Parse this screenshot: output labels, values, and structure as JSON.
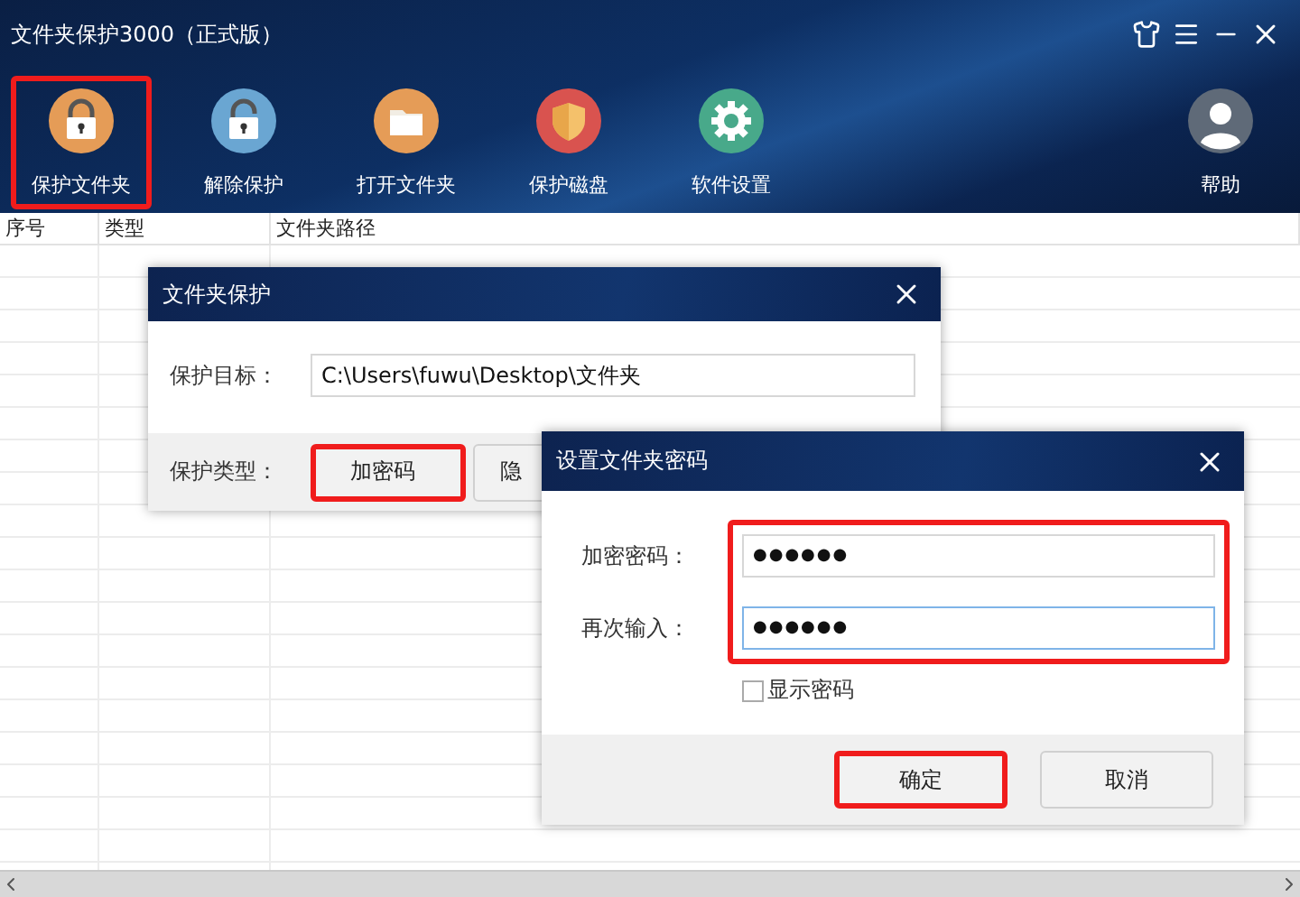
{
  "window": {
    "title": "文件夹保护3000（正式版）"
  },
  "toolbar": [
    {
      "label": "保护文件夹",
      "kind": "lock",
      "highlighted": true
    },
    {
      "label": "解除保护",
      "kind": "unlock",
      "highlighted": false
    },
    {
      "label": "打开文件夹",
      "kind": "folder",
      "highlighted": false
    },
    {
      "label": "保护磁盘",
      "kind": "shield",
      "highlighted": false
    },
    {
      "label": "软件设置",
      "kind": "gear",
      "highlighted": false
    }
  ],
  "help": {
    "label": "帮助"
  },
  "table": {
    "columns": [
      "序号",
      "类型",
      "文件夹路径"
    ]
  },
  "protect_dialog": {
    "title": "文件夹保护",
    "target_label": "保护目标：",
    "target_value": "C:\\Users\\fuwu\\Desktop\\文件夹",
    "type_label": "保护类型：",
    "type_buttons": [
      {
        "label": "加密码",
        "highlighted": true
      },
      {
        "label": "隐",
        "highlighted": false
      }
    ]
  },
  "password_dialog": {
    "title": "设置文件夹密码",
    "fields_highlighted": true,
    "fields": [
      {
        "label": "加密密码：",
        "value": "●●●●●●",
        "focused": false
      },
      {
        "label": "再次输入：",
        "value": "●●●●●●",
        "focused": true
      }
    ],
    "show_password": {
      "label": "显示密码",
      "checked": false
    },
    "buttons": [
      {
        "label": "确定",
        "highlighted": true
      },
      {
        "label": "取消",
        "highlighted": false
      }
    ]
  }
}
